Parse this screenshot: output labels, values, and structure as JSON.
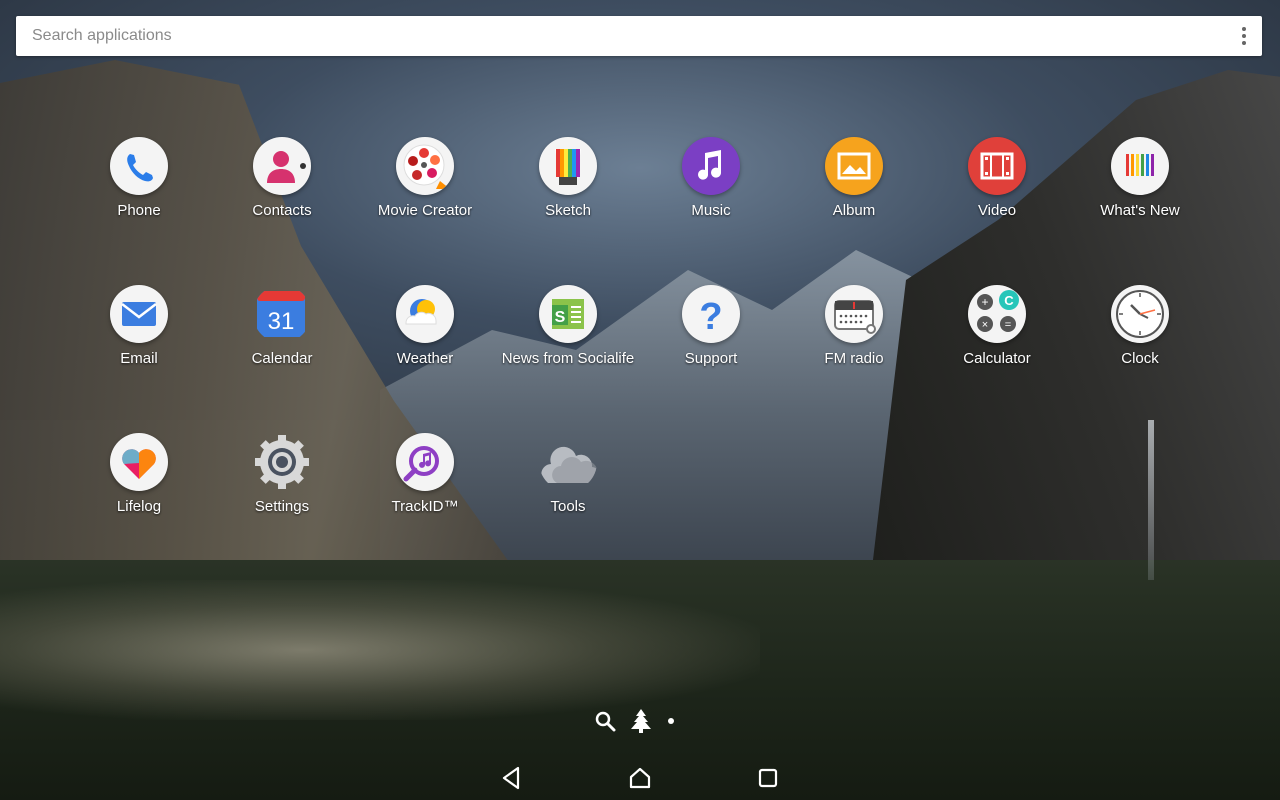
{
  "search": {
    "placeholder": "Search applications"
  },
  "apps": [
    {
      "label": "Phone",
      "icon": "phone-icon"
    },
    {
      "label": "Contacts",
      "icon": "contacts-icon"
    },
    {
      "label": "Movie Creator",
      "icon": "movie-creator-icon"
    },
    {
      "label": "Sketch",
      "icon": "sketch-icon"
    },
    {
      "label": "Music",
      "icon": "music-icon"
    },
    {
      "label": "Album",
      "icon": "album-icon"
    },
    {
      "label": "Video",
      "icon": "video-icon"
    },
    {
      "label": "What's New",
      "icon": "whats-new-icon"
    },
    {
      "label": "Email",
      "icon": "email-icon"
    },
    {
      "label": "Calendar",
      "icon": "calendar-icon",
      "badge": "31"
    },
    {
      "label": "Weather",
      "icon": "weather-icon"
    },
    {
      "label": "News from Socialife",
      "icon": "news-icon",
      "badge": "S"
    },
    {
      "label": "Support",
      "icon": "support-icon",
      "badge": "?"
    },
    {
      "label": "FM radio",
      "icon": "fm-radio-icon"
    },
    {
      "label": "Calculator",
      "icon": "calculator-icon"
    },
    {
      "label": "Clock",
      "icon": "clock-icon"
    },
    {
      "label": "Lifelog",
      "icon": "lifelog-icon"
    },
    {
      "label": "Settings",
      "icon": "settings-icon"
    },
    {
      "label": "TrackID™",
      "icon": "trackid-icon"
    },
    {
      "label": "Tools",
      "icon": "tools-folder-icon"
    }
  ],
  "indicators": [
    "search-icon",
    "tree-icon",
    "page-dot-icon"
  ],
  "navbar": [
    "back-icon",
    "home-icon",
    "recents-icon"
  ]
}
